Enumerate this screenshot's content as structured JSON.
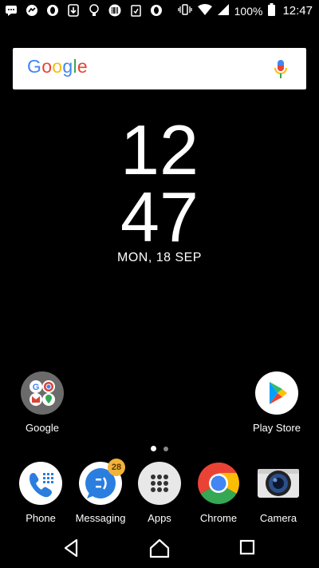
{
  "status_bar": {
    "notification_icons": [
      "message-icon",
      "messenger-icon",
      "opera-icon",
      "download-app-icon",
      "lightbulb-icon",
      "barcode-icon",
      "clipboard-check-icon",
      "opera-icon"
    ],
    "battery_percent": "100%",
    "time": "12:47"
  },
  "search": {
    "logo_letters": [
      {
        "ch": "G",
        "color": "#4285F4"
      },
      {
        "ch": "o",
        "color": "#EA4335"
      },
      {
        "ch": "o",
        "color": "#FBBC05"
      },
      {
        "ch": "g",
        "color": "#4285F4"
      },
      {
        "ch": "l",
        "color": "#34A853"
      },
      {
        "ch": "e",
        "color": "#EA4335"
      }
    ],
    "mic_icon": "microphone-icon"
  },
  "clock": {
    "hour": "12",
    "minute": "47",
    "date": "MON, 18 SEP"
  },
  "home_apps": {
    "google_folder": "Google",
    "play_store": "Play Store"
  },
  "page_indicator": {
    "pages": 2,
    "current": 1
  },
  "dock": {
    "phone": "Phone",
    "messaging": "Messaging",
    "messaging_badge": "28",
    "apps": "Apps",
    "chrome": "Chrome",
    "camera": "Camera"
  },
  "nav": [
    "back-icon",
    "home-icon",
    "recents-icon"
  ]
}
